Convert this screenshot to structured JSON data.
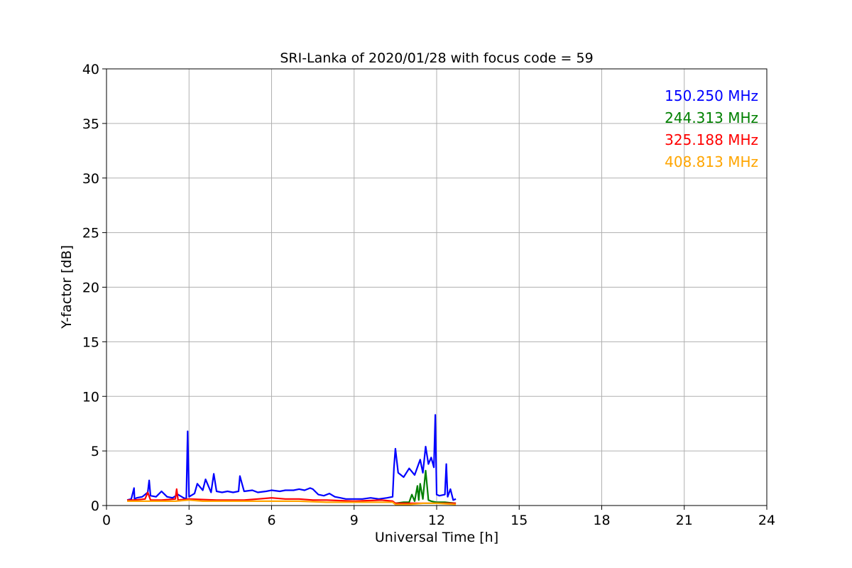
{
  "chart_data": {
    "type": "line",
    "title": "SRI-Lanka of 2020/01/28 with focus code = 59",
    "xlabel": "Universal Time [h]",
    "ylabel": "Y-factor [dB]",
    "xlim": [
      0,
      24
    ],
    "ylim": [
      0,
      40
    ],
    "xticks": [
      0,
      3,
      6,
      9,
      12,
      15,
      18,
      21,
      24
    ],
    "yticks": [
      0,
      5,
      10,
      15,
      20,
      25,
      30,
      35,
      40
    ],
    "grid": true,
    "legend_position": "top-right",
    "series": [
      {
        "name": "150.250 MHz",
        "color": "#0000ff",
        "x": [
          0.75,
          0.9,
          1.0,
          1.02,
          1.1,
          1.3,
          1.5,
          1.55,
          1.6,
          1.8,
          2.0,
          2.2,
          2.4,
          2.6,
          2.8,
          2.9,
          2.95,
          3.0,
          3.2,
          3.3,
          3.5,
          3.6,
          3.8,
          3.9,
          4.0,
          4.2,
          4.4,
          4.6,
          4.8,
          4.85,
          5.0,
          5.3,
          5.5,
          5.8,
          6.0,
          6.3,
          6.5,
          6.8,
          7.0,
          7.2,
          7.4,
          7.5,
          7.7,
          7.9,
          8.1,
          8.3,
          8.5,
          8.7,
          9.0,
          9.3,
          9.6,
          9.9,
          10.2,
          10.4,
          10.45,
          10.5,
          10.6,
          10.8,
          11.0,
          11.2,
          11.4,
          11.5,
          11.6,
          11.7,
          11.8,
          11.9,
          11.95,
          12.0,
          12.1,
          12.3,
          12.35,
          12.4,
          12.5,
          12.6,
          12.7
        ],
        "y": [
          0.5,
          0.6,
          1.6,
          0.6,
          0.7,
          0.8,
          1.2,
          2.3,
          0.9,
          0.8,
          1.3,
          0.8,
          0.7,
          1.0,
          0.7,
          0.6,
          6.8,
          0.8,
          1.1,
          2.0,
          1.4,
          2.4,
          1.2,
          2.9,
          1.3,
          1.2,
          1.3,
          1.2,
          1.3,
          2.7,
          1.3,
          1.4,
          1.2,
          1.3,
          1.4,
          1.3,
          1.4,
          1.4,
          1.5,
          1.4,
          1.6,
          1.5,
          1.0,
          0.9,
          1.1,
          0.8,
          0.7,
          0.6,
          0.6,
          0.6,
          0.7,
          0.6,
          0.7,
          0.8,
          3.5,
          5.2,
          3.0,
          2.6,
          3.4,
          2.8,
          4.2,
          3.0,
          5.4,
          3.8,
          4.4,
          3.5,
          8.3,
          1.0,
          0.9,
          1.0,
          3.8,
          0.8,
          1.5,
          0.5,
          0.6
        ]
      },
      {
        "name": "244.313 MHz",
        "color": "#008000",
        "x": [
          10.5,
          10.8,
          11.0,
          11.1,
          11.2,
          11.3,
          11.35,
          11.4,
          11.5,
          11.6,
          11.7,
          11.8,
          12.0,
          12.3,
          12.7
        ],
        "y": [
          0.2,
          0.3,
          0.3,
          1.0,
          0.4,
          1.8,
          0.5,
          2.0,
          0.6,
          3.2,
          0.5,
          0.4,
          0.3,
          0.3,
          0.2
        ]
      },
      {
        "name": "325.188 MHz",
        "color": "#ff0000",
        "x": [
          0.75,
          1.0,
          1.4,
          1.5,
          1.6,
          2.0,
          2.5,
          2.55,
          2.6,
          3.0,
          4.0,
          5.0,
          5.5,
          6.0,
          6.5,
          7.0,
          7.5,
          8.0,
          9.0,
          10.0,
          10.4,
          10.5,
          11.0,
          12.0,
          12.7
        ],
        "y": [
          0.5,
          0.5,
          0.6,
          1.2,
          0.5,
          0.5,
          0.6,
          1.5,
          0.5,
          0.6,
          0.5,
          0.5,
          0.6,
          0.7,
          0.6,
          0.6,
          0.5,
          0.5,
          0.4,
          0.5,
          0.4,
          0.2,
          0.2,
          0.2,
          0.2
        ]
      },
      {
        "name": "408.813 MHz",
        "color": "#ffa500",
        "x": [
          0.75,
          1.5,
          2.0,
          2.5,
          3.0,
          3.5,
          4.0,
          5.0,
          6.0,
          7.0,
          8.0,
          9.0,
          10.0,
          10.4,
          10.5,
          11.0,
          11.5,
          12.0,
          12.7
        ],
        "y": [
          0.4,
          0.4,
          0.4,
          0.4,
          0.5,
          0.4,
          0.4,
          0.4,
          0.4,
          0.4,
          0.3,
          0.3,
          0.3,
          0.3,
          0.1,
          0.1,
          0.2,
          0.2,
          0.1
        ]
      }
    ]
  }
}
